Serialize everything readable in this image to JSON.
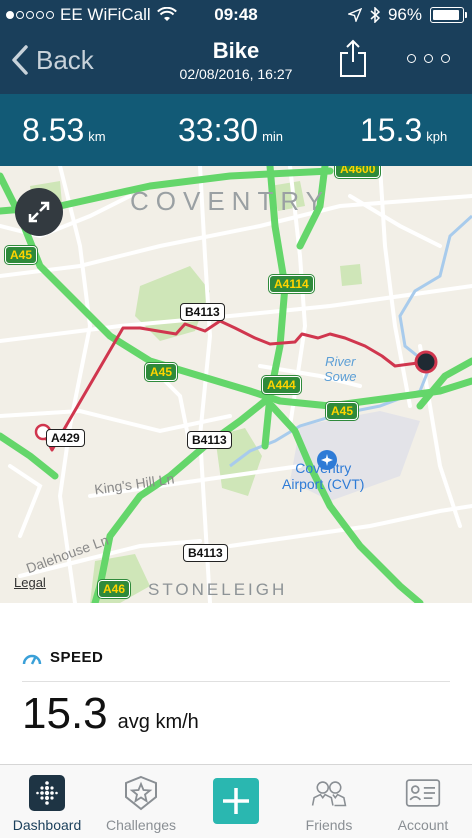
{
  "status_bar": {
    "carrier": "EE WiFiCall",
    "time": "09:48",
    "battery": "96%",
    "signal_bars": 1,
    "signal_total": 5
  },
  "nav": {
    "back_label": "Back",
    "title": "Bike",
    "subtitle": "02/08/2016, 16:27",
    "share_icon": "share-icon",
    "more_icon": "more-icon"
  },
  "stats": {
    "distance": {
      "value": "8.53",
      "unit": "km"
    },
    "duration": {
      "value": "33:30",
      "unit": "min"
    },
    "speed": {
      "value": "15.3",
      "unit": "kph"
    }
  },
  "map": {
    "city": "COVENTRY",
    "area": "STONELEIGH",
    "river": "River\nSowe",
    "airport": "Coventry\nAirport (CVT)",
    "streets": [
      "King's Hill Ln",
      "Dalehouse Ln"
    ],
    "legal": "Legal",
    "road_labels": {
      "a45_left": "A45",
      "a4600": "A4600",
      "a4114": "A4114",
      "b4113_top": "B4113",
      "a45_mid": "A45",
      "a444": "A444",
      "a45_right": "A45",
      "a429": "A429",
      "b4113_mid": "B4113",
      "b4113_bottom": "B4113",
      "a46": "A46"
    },
    "route_color": "#d0364e",
    "motorway_color": "#64d66a"
  },
  "speed": {
    "heading": "SPEED",
    "value": "15.3",
    "unit": "avg km/h"
  },
  "tabs": [
    {
      "label": "Dashboard",
      "icon": "dashboard-icon",
      "active": true
    },
    {
      "label": "Challenges",
      "icon": "challenges-star-icon",
      "active": false
    },
    {
      "label": "",
      "icon": "plus-icon",
      "active": false
    },
    {
      "label": "Friends",
      "icon": "friends-icon",
      "active": false
    },
    {
      "label": "Account",
      "icon": "account-card-icon",
      "active": false
    }
  ]
}
